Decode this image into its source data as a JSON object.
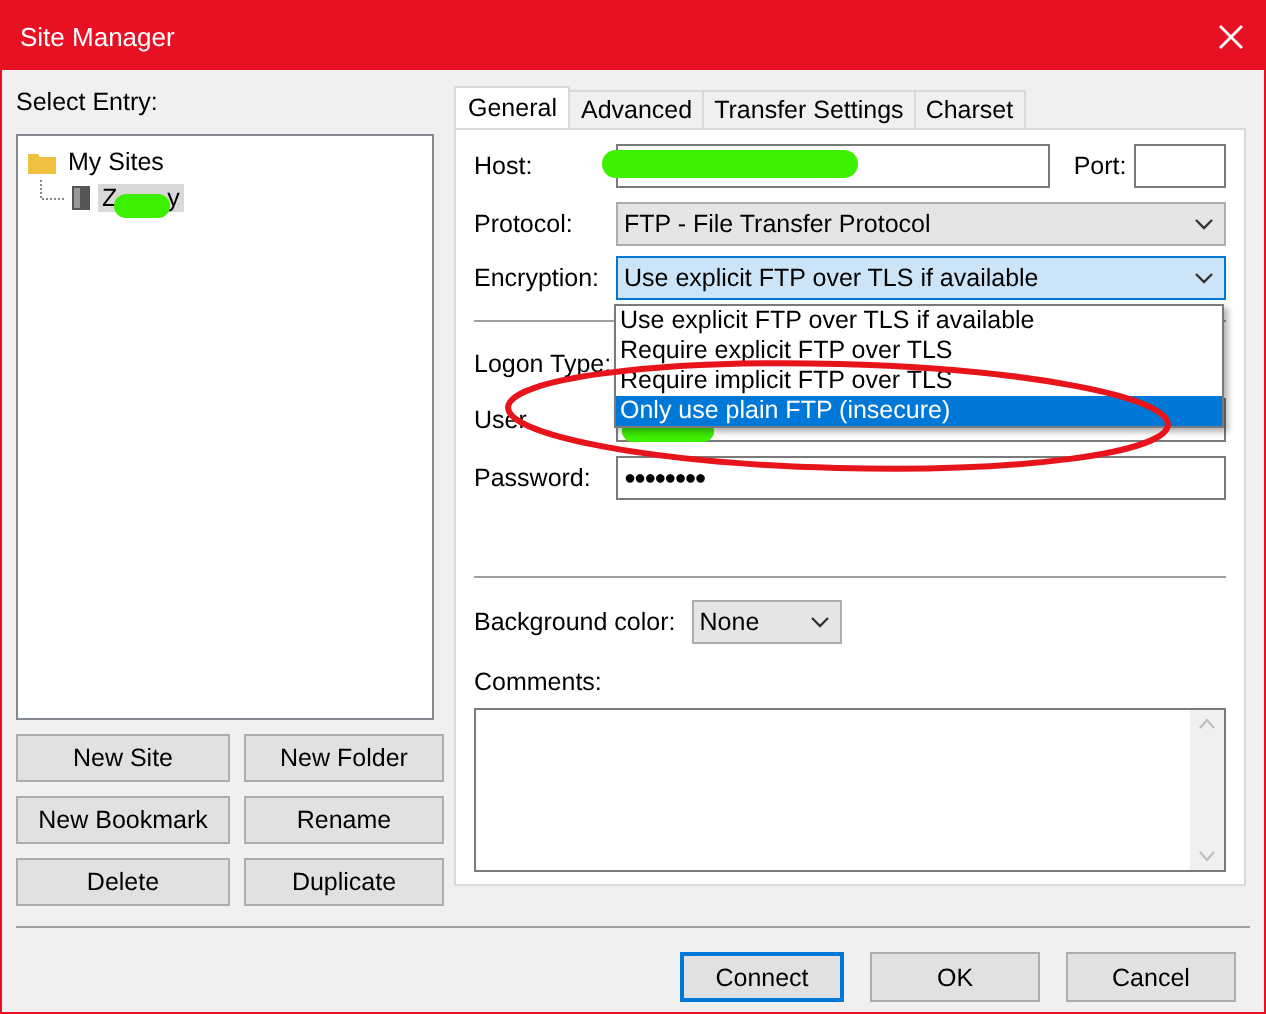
{
  "window": {
    "title": "Site Manager"
  },
  "select_entry_label": "Select Entry:",
  "tree": [
    {
      "kind": "folder",
      "label": "My Sites",
      "selected": false,
      "children": [
        {
          "kind": "site",
          "label": "Z",
          "label_end": "y",
          "selected": true,
          "redacted": true
        }
      ]
    }
  ],
  "entry_buttons": [
    "New Site",
    "New Folder",
    "New Bookmark",
    "Rename",
    "Delete",
    "Duplicate"
  ],
  "tabs": [
    {
      "label": "General",
      "selected": true
    },
    {
      "label": "Advanced",
      "selected": false
    },
    {
      "label": "Transfer Settings",
      "selected": false
    },
    {
      "label": "Charset",
      "selected": false
    }
  ],
  "host": {
    "label": "Host:",
    "redacted": true
  },
  "port": {
    "label": "Port:"
  },
  "protocol": {
    "label": "Protocol:",
    "value": "FTP - File Transfer Protocol"
  },
  "encryption": {
    "label": "Encryption:",
    "value": "Use explicit FTP over TLS if available",
    "open": true,
    "options": [
      {
        "label": "Use explicit FTP over TLS if available",
        "highlighted": false
      },
      {
        "label": "Require explicit FTP over TLS",
        "highlighted": false
      },
      {
        "label": "Require implicit FTP over TLS",
        "highlighted": false
      },
      {
        "label": "Only use plain FTP (insecure)",
        "highlighted": true
      }
    ]
  },
  "logon_type": {
    "label": "Logon Type:"
  },
  "user": {
    "label": "User",
    "redacted": true
  },
  "password": {
    "label": "Password:",
    "value": "●●●●●●●●"
  },
  "background_color": {
    "label": "Background color:",
    "value": "None"
  },
  "comments": {
    "label": "Comments:"
  },
  "dialog_buttons": [
    {
      "label": "Connect",
      "default": true
    },
    {
      "label": "OK",
      "default": false
    },
    {
      "label": "Cancel",
      "default": false
    }
  ],
  "annotation": {
    "kind": "ellipse"
  }
}
